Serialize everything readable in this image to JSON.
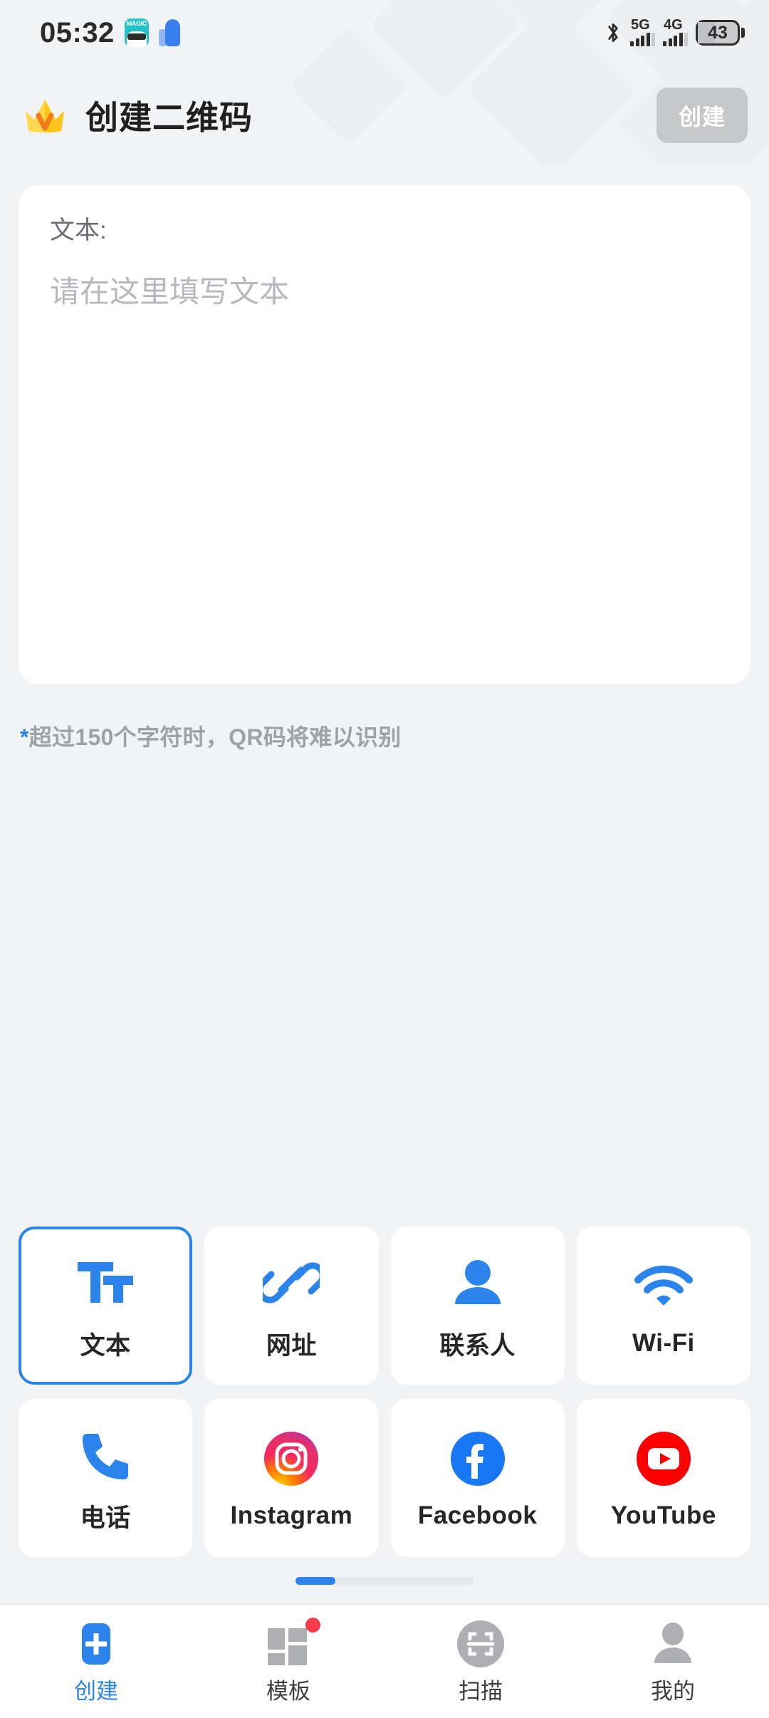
{
  "status_bar": {
    "time": "05:32",
    "magic_icon_text": "MAGIC",
    "network_5g_label": "5G",
    "network_4g_label": "4G",
    "battery_percent": "43"
  },
  "header": {
    "crown_icon": "crown-icon",
    "title": "创建二维码",
    "create_button_label": "创建",
    "create_button_enabled": false,
    "create_button_bg": "#c6c7c9"
  },
  "form": {
    "field_label": "文本:",
    "input_value": "",
    "input_placeholder": "请在这里填写文本",
    "hint_star": "*",
    "hint_text": "超过150个字符时，QR码将难以识别"
  },
  "type_grid": {
    "selected_index": 0,
    "selected_border_color": "#2b84ec",
    "items": [
      {
        "label": "文本",
        "icon": "text-format-icon",
        "icon_color": "#2b84ec"
      },
      {
        "label": "网址",
        "icon": "link-icon",
        "icon_color": "#2b84ec"
      },
      {
        "label": "联系人",
        "icon": "person-icon",
        "icon_color": "#2b84ec"
      },
      {
        "label": "Wi-Fi",
        "icon": "wifi-icon",
        "icon_color": "#2b84ec"
      },
      {
        "label": "电话",
        "icon": "phone-icon",
        "icon_color": "#2b84ec"
      },
      {
        "label": "Instagram",
        "icon": "instagram-icon",
        "icon_color": "#e1306c"
      },
      {
        "label": "Facebook",
        "icon": "facebook-icon",
        "icon_color": "#1877f2"
      },
      {
        "label": "YouTube",
        "icon": "youtube-icon",
        "icon_color": "#ff0000"
      }
    ]
  },
  "pager": {
    "pages": 2,
    "active_page": 1,
    "active_color": "#2b84ec"
  },
  "bottom_nav": {
    "active_index": 0,
    "active_color": "#2b84ec",
    "items": [
      {
        "label": "创建",
        "icon": "plus-square-icon",
        "badge": false
      },
      {
        "label": "模板",
        "icon": "grid-icon",
        "badge": true
      },
      {
        "label": "扫描",
        "icon": "scan-circle-icon",
        "badge": false
      },
      {
        "label": "我的",
        "icon": "person-icon",
        "badge": false
      }
    ]
  }
}
